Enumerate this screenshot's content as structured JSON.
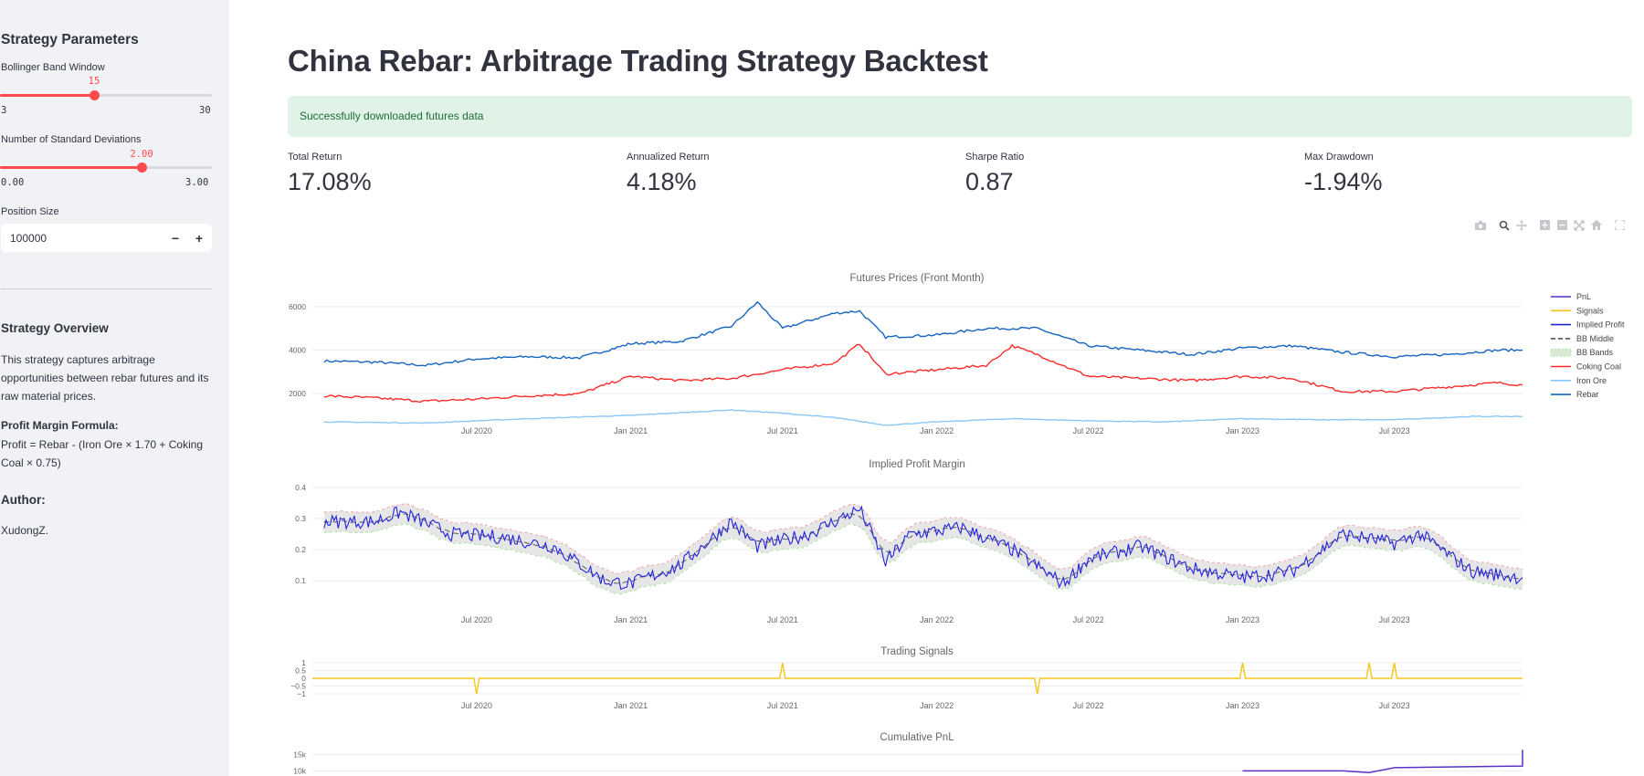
{
  "sidebar": {
    "title": "Strategy Parameters",
    "bb_window": {
      "label": "Bollinger Band Window",
      "value": "15",
      "min": "3",
      "max": "30",
      "fraction": 0.444
    },
    "num_std": {
      "label": "Number of Standard Deviations",
      "value": "2.00",
      "min": "0.00",
      "max": "3.00",
      "fraction": 0.667
    },
    "position_size": {
      "label": "Position Size",
      "value": "100000",
      "minus": "−",
      "plus": "+"
    },
    "overview": {
      "heading": "Strategy Overview",
      "text": "This strategy captures arbitrage opportunities between rebar futures and its raw material prices.",
      "formula_heading": "Profit Margin Formula:",
      "formula": "Profit = Rebar - (Iron Ore × 1.70 + Coking Coal × 0.75)"
    },
    "author": {
      "heading": "Author:",
      "name": "XudongZ."
    }
  },
  "main": {
    "title": "China Rebar: Arbitrage Trading Strategy Backtest",
    "alert": "Successfully downloaded futures data",
    "metrics": [
      {
        "label": "Total Return",
        "value": "17.08%"
      },
      {
        "label": "Annualized Return",
        "value": "4.18%"
      },
      {
        "label": "Sharpe Ratio",
        "value": "0.87"
      },
      {
        "label": "Max Drawdown",
        "value": "-1.94%"
      }
    ]
  },
  "modebar": [
    "camera-icon",
    "zoom-icon",
    "pan-icon",
    "zoom-in-icon",
    "zoom-out-icon",
    "autoscale-icon",
    "reset-axes-icon",
    "fullscreen-icon"
  ],
  "chart_data": [
    {
      "type": "line",
      "title": "Futures Prices (Front Month)",
      "x_ticks": [
        "Jul 2020",
        "Jan 2021",
        "Jul 2021",
        "Jan 2022",
        "Jul 2022",
        "Jan 2023",
        "Jul 2023"
      ],
      "x_range": [
        "2020-01",
        "2023-12"
      ],
      "y_ticks": [
        "2000",
        "4000",
        "6000"
      ],
      "ylim": [
        1000,
        6500
      ],
      "series": [
        {
          "name": "Rebar",
          "color": "#1565c0",
          "x": [
            "2020-01",
            "2020-03",
            "2020-05",
            "2020-07",
            "2020-09",
            "2020-11",
            "2021-01",
            "2021-03",
            "2021-05",
            "2021-06",
            "2021-07",
            "2021-09",
            "2021-10",
            "2021-11",
            "2022-01",
            "2022-03",
            "2022-05",
            "2022-07",
            "2022-09",
            "2022-11",
            "2023-01",
            "2023-03",
            "2023-05",
            "2023-07",
            "2023-09",
            "2023-11",
            "2023-12"
          ],
          "values": [
            3500,
            3450,
            3300,
            3600,
            3700,
            3650,
            4300,
            4400,
            5100,
            6200,
            5000,
            5700,
            5800,
            4600,
            4700,
            5000,
            5000,
            4200,
            4000,
            3800,
            4100,
            4200,
            3900,
            3700,
            3800,
            4000,
            4000
          ]
        },
        {
          "name": "Coking Coal",
          "color": "#ff2b2b",
          "x": [
            "2020-01",
            "2020-03",
            "2020-05",
            "2020-07",
            "2020-09",
            "2020-11",
            "2021-01",
            "2021-03",
            "2021-05",
            "2021-07",
            "2021-09",
            "2021-10",
            "2021-11",
            "2022-01",
            "2022-03",
            "2022-04",
            "2022-05",
            "2022-07",
            "2022-09",
            "2022-11",
            "2023-01",
            "2023-03",
            "2023-05",
            "2023-07",
            "2023-09",
            "2023-11",
            "2023-12"
          ],
          "values": [
            1900,
            1800,
            1650,
            1750,
            1900,
            2000,
            2800,
            2600,
            2700,
            3100,
            3400,
            4300,
            2900,
            3100,
            3300,
            4200,
            3800,
            2800,
            2700,
            2600,
            2800,
            2700,
            2100,
            2100,
            2300,
            2500,
            2400
          ]
        },
        {
          "name": "Iron Ore",
          "color": "#8ac7f5",
          "x": [
            "2020-01",
            "2020-05",
            "2020-09",
            "2021-01",
            "2021-05",
            "2021-07",
            "2021-09",
            "2021-11",
            "2022-01",
            "2022-04",
            "2022-07",
            "2022-10",
            "2023-01",
            "2023-04",
            "2023-07",
            "2023-10",
            "2023-12"
          ],
          "values": [
            700,
            650,
            850,
            1000,
            1250,
            1100,
            900,
            550,
            700,
            850,
            750,
            700,
            850,
            800,
            800,
            950,
            950
          ]
        }
      ],
      "legend": [
        "PnL",
        "Signals",
        "Implied Profit",
        "BB Middle",
        "BB Bands",
        "Coking Coal",
        "Iron Ore",
        "Rebar"
      ],
      "legend_position": "right"
    },
    {
      "type": "line",
      "title": "Implied Profit Margin",
      "x_ticks": [
        "Jul 2020",
        "Jan 2021",
        "Jul 2021",
        "Jan 2022",
        "Jul 2022",
        "Jan 2023",
        "Jul 2023"
      ],
      "y_ticks": [
        "0.1",
        "0.2",
        "0.3",
        "0.4"
      ],
      "ylim": [
        0.03,
        0.42
      ],
      "series": [
        {
          "name": "Implied Profit",
          "color": "#2222dd",
          "x": [
            "2020-01",
            "2020-03",
            "2020-04",
            "2020-06",
            "2020-08",
            "2020-10",
            "2020-12",
            "2021-01",
            "2021-03",
            "2021-05",
            "2021-06",
            "2021-08",
            "2021-10",
            "2021-11",
            "2021-12",
            "2022-02",
            "2022-04",
            "2022-06",
            "2022-07",
            "2022-09",
            "2022-11",
            "2023-01",
            "2023-03",
            "2023-05",
            "2023-07",
            "2023-08",
            "2023-10",
            "2023-12"
          ],
          "values": [
            0.29,
            0.29,
            0.32,
            0.25,
            0.24,
            0.21,
            0.1,
            0.09,
            0.15,
            0.29,
            0.21,
            0.25,
            0.33,
            0.16,
            0.25,
            0.27,
            0.2,
            0.09,
            0.17,
            0.21,
            0.14,
            0.11,
            0.13,
            0.25,
            0.22,
            0.25,
            0.13,
            0.11
          ]
        },
        {
          "name": "BB Middle",
          "color": "#555555"
        },
        {
          "name": "BB Bands",
          "color": "#cccccc"
        }
      ]
    },
    {
      "type": "line",
      "title": "Trading Signals",
      "x_ticks": [
        "Jul 2020",
        "Jan 2021",
        "Jul 2021",
        "Jan 2022",
        "Jul 2022",
        "Jan 2023",
        "Jul 2023"
      ],
      "y_ticks": [
        "1",
        "0.5",
        "0",
        "−0.5",
        "−1"
      ],
      "ylim": [
        -1,
        1
      ],
      "series": [
        {
          "name": "Signals",
          "color": "#f5c518",
          "spikes": [
            [
              "2020-07",
              -1
            ],
            [
              "2021-07",
              1
            ],
            [
              "2022-05",
              -1
            ],
            [
              "2023-01",
              1
            ],
            [
              "2023-06",
              1
            ],
            [
              "2023-07",
              1
            ]
          ]
        }
      ]
    },
    {
      "type": "line",
      "title": "Cumulative PnL",
      "y_ticks": [
        "15k",
        "10k"
      ],
      "series": [
        {
          "name": "PnL",
          "color": "#5b2fc9",
          "x": [
            "2023-01",
            "2023-05",
            "2023-06",
            "2023-07",
            "2023-12"
          ],
          "values": [
            10000,
            10000,
            9500,
            11000,
            11500
          ]
        }
      ]
    }
  ]
}
